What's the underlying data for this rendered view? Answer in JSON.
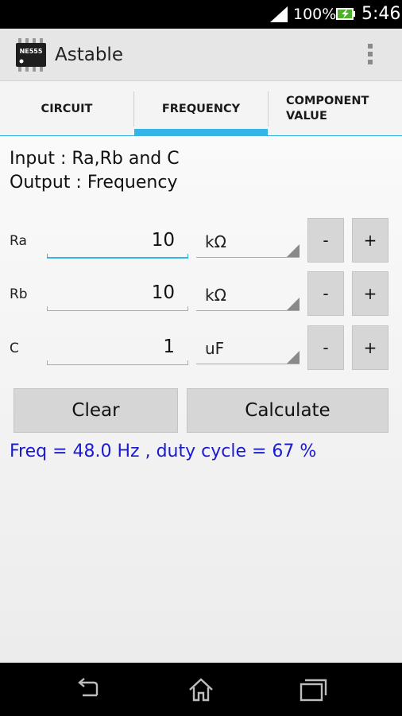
{
  "status_bar": {
    "battery_percent": "100%",
    "time": "5:46",
    "icons": [
      "signal-icon",
      "battery-charging-icon"
    ]
  },
  "action_bar": {
    "chip_label": "NE555",
    "title": "Astable",
    "icons": [
      "ic-chip-icon",
      "overflow-menu-icon"
    ]
  },
  "tabs": [
    {
      "label": "CIRCUIT",
      "selected": false
    },
    {
      "label": "FREQUENCY",
      "selected": true
    },
    {
      "label": "COMPONENT VALUE",
      "selected": false
    }
  ],
  "info": {
    "input_line": "Input : Ra,Rb and C",
    "output_line": "Output : Frequency"
  },
  "rows": [
    {
      "label": "Ra",
      "value": "10",
      "unit": "kΩ",
      "minus": "-",
      "plus": "+"
    },
    {
      "label": "Rb",
      "value": "10",
      "unit": "kΩ",
      "minus": "-",
      "plus": "+"
    },
    {
      "label": "C",
      "value": "1",
      "unit": "uF",
      "minus": "-",
      "plus": "+"
    }
  ],
  "buttons": {
    "clear": "Clear",
    "calculate": "Calculate"
  },
  "result": "Freq = 48.0 Hz , duty cycle = 67 %",
  "nav_bar": {
    "icons": [
      "back-icon",
      "home-icon",
      "recent-apps-icon"
    ]
  },
  "colors": {
    "accent": "#33b5e5",
    "result_text": "#1a1ad0",
    "button_bg": "#d6d6d6"
  }
}
